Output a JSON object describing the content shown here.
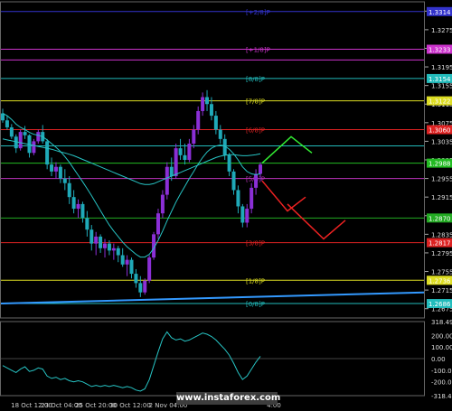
{
  "watermark": "www.instaforex.com",
  "colors": {
    "background": "#000000",
    "bull_candle": "#8b2fd6",
    "bear_candle": "#1fa9b8",
    "ma_fast": "#27c4c4",
    "ma_slow": "#27c4c4",
    "up_arrow": "#33ee33",
    "down_arrow": "#ee2222",
    "oscillator": "#27c4c4"
  },
  "chart_data": {
    "type": "candlestick",
    "y_range": [
      1.2655,
      1.3335
    ],
    "price_ticks": [
      "1.3315",
      "1.3275",
      "1.3235",
      "1.3195",
      "1.3155",
      "1.3115",
      "1.3075",
      "1.3035",
      "1.2995",
      "1.2955",
      "1.2915",
      "1.2875",
      "1.2835",
      "1.2795",
      "1.2755",
      "1.2715",
      "1.2675"
    ],
    "time_labels": [
      "18 Oct 12:00",
      "23 Oct 04:00",
      "25 Oct 20:00",
      "30 Oct 12:00",
      "2 Nov 04:00",
      "4:00"
    ],
    "levels": [
      {
        "label": "[+2/8]P",
        "price": 1.3314,
        "color": "#3333cc",
        "tag": "1.3314"
      },
      {
        "label": "[+1/8]P",
        "price": 1.3233,
        "color": "#cc33cc",
        "tag": "1.3233"
      },
      {
        "label": "",
        "price": 1.321,
        "color": "#cc33cc",
        "tag": ""
      },
      {
        "label": "[8/8]P",
        "price": 1.317,
        "color": "#22bbbb",
        "tag": "1.3154"
      },
      {
        "label": "[7/8]P",
        "price": 1.3122,
        "color": "#dddd22",
        "tag": "1.3122"
      },
      {
        "label": "[6/8]P",
        "price": 1.306,
        "color": "#dd2222",
        "tag": "1.3060"
      },
      {
        "label": "",
        "price": 1.3025,
        "color": "#22bbbb",
        "tag": ""
      },
      {
        "label": "",
        "price": 1.2988,
        "color": "#22bb22",
        "tag": "1.2988"
      },
      {
        "label": "[5/8]P",
        "price": 1.2955,
        "color": "#bb33bb",
        "tag": ""
      },
      {
        "label": "",
        "price": 1.287,
        "color": "#22aa22",
        "tag": "1.2870"
      },
      {
        "label": "[3/8]P",
        "price": 1.2817,
        "color": "#dd2222",
        "tag": "1.2817"
      },
      {
        "label": "[1/8]P",
        "price": 1.2736,
        "color": "#dddd22",
        "tag": "1.2736"
      },
      {
        "label": "[0/8]P",
        "price": 1.2686,
        "color": "#22bbbb",
        "tag": "1.2686"
      }
    ],
    "candles": [
      [
        1.3095,
        1.3105,
        1.3075,
        1.308
      ],
      [
        1.308,
        1.309,
        1.306,
        1.3065
      ],
      [
        1.3065,
        1.3072,
        1.304,
        1.3045
      ],
      [
        1.3045,
        1.305,
        1.301,
        1.302
      ],
      [
        1.302,
        1.306,
        1.3015,
        1.3055
      ],
      [
        1.3055,
        1.3068,
        1.304,
        1.3048
      ],
      [
        1.3048,
        1.305,
        1.3,
        1.301
      ],
      [
        1.301,
        1.304,
        1.3005,
        1.3035
      ],
      [
        1.3035,
        1.306,
        1.303,
        1.3055
      ],
      [
        1.3055,
        1.307,
        1.303,
        1.3035
      ],
      [
        1.3035,
        1.304,
        1.2975,
        1.2985
      ],
      [
        1.2985,
        1.3,
        1.296,
        1.297
      ],
      [
        1.297,
        1.299,
        1.2955,
        1.298
      ],
      [
        1.298,
        1.2985,
        1.2945,
        1.2955
      ],
      [
        1.2955,
        1.2975,
        1.293,
        1.2945
      ],
      [
        1.2945,
        1.296,
        1.29,
        1.2915
      ],
      [
        1.2915,
        1.293,
        1.288,
        1.289
      ],
      [
        1.289,
        1.291,
        1.287,
        1.29
      ],
      [
        1.29,
        1.2905,
        1.286,
        1.287
      ],
      [
        1.287,
        1.2885,
        1.283,
        1.2845
      ],
      [
        1.2845,
        1.2855,
        1.28,
        1.2815
      ],
      [
        1.2815,
        1.284,
        1.279,
        1.283
      ],
      [
        1.283,
        1.2835,
        1.2795,
        1.2805
      ],
      [
        1.2805,
        1.2825,
        1.2785,
        1.2815
      ],
      [
        1.2815,
        1.2822,
        1.279,
        1.28
      ],
      [
        1.28,
        1.2815,
        1.278,
        1.2805
      ],
      [
        1.2805,
        1.281,
        1.2775,
        1.279
      ],
      [
        1.279,
        1.2805,
        1.2765,
        1.277
      ],
      [
        1.277,
        1.279,
        1.2745,
        1.278
      ],
      [
        1.278,
        1.2785,
        1.274,
        1.275
      ],
      [
        1.275,
        1.276,
        1.272,
        1.273
      ],
      [
        1.273,
        1.2745,
        1.27,
        1.271
      ],
      [
        1.271,
        1.274,
        1.2705,
        1.2735
      ],
      [
        1.2735,
        1.279,
        1.273,
        1.2785
      ],
      [
        1.2785,
        1.284,
        1.278,
        1.2835
      ],
      [
        1.2835,
        1.289,
        1.2825,
        1.288
      ],
      [
        1.288,
        1.293,
        1.287,
        1.292
      ],
      [
        1.292,
        1.299,
        1.291,
        1.298
      ],
      [
        1.298,
        1.3,
        1.295,
        1.296
      ],
      [
        1.296,
        1.303,
        1.2955,
        1.302
      ],
      [
        1.302,
        1.304,
        1.2995,
        1.3005
      ],
      [
        1.3005,
        1.303,
        1.2985,
        1.2995
      ],
      [
        1.2995,
        1.304,
        1.299,
        1.303
      ],
      [
        1.303,
        1.307,
        1.302,
        1.306
      ],
      [
        1.306,
        1.311,
        1.305,
        1.31
      ],
      [
        1.31,
        1.314,
        1.309,
        1.313
      ],
      [
        1.313,
        1.3145,
        1.31,
        1.3115
      ],
      [
        1.3115,
        1.313,
        1.308,
        1.309
      ],
      [
        1.309,
        1.31,
        1.305,
        1.306
      ],
      [
        1.306,
        1.307,
        1.303,
        1.304
      ],
      [
        1.304,
        1.305,
        1.2995,
        1.3005
      ],
      [
        1.3005,
        1.301,
        1.296,
        1.297
      ],
      [
        1.297,
        1.2975,
        1.292,
        1.293
      ],
      [
        1.293,
        1.294,
        1.288,
        1.2895
      ],
      [
        1.2895,
        1.29,
        1.285,
        1.286
      ],
      [
        1.286,
        1.29,
        1.285,
        1.289
      ],
      [
        1.289,
        1.2945,
        1.288,
        1.2935
      ],
      [
        1.2935,
        1.2975,
        1.292,
        1.2965
      ],
      [
        1.2965,
        1.299,
        1.295,
        1.2985
      ]
    ],
    "ma_fast": [
      1.3095,
      1.309,
      1.3082,
      1.3072,
      1.3065,
      1.306,
      1.3054,
      1.305,
      1.3048,
      1.3045,
      1.3038,
      1.303,
      1.3022,
      1.3013,
      1.3002,
      1.299,
      1.2976,
      1.2962,
      1.2948,
      1.2933,
      1.2918,
      1.2902,
      1.2886,
      1.287,
      1.2855,
      1.2842,
      1.283,
      1.2818,
      1.2808,
      1.28,
      1.2792,
      1.2786,
      1.2786,
      1.2792,
      1.2805,
      1.2822,
      1.2842,
      1.2864,
      1.2884,
      1.2904,
      1.2922,
      1.2938,
      1.2955,
      1.297,
      1.2986,
      1.3,
      1.3012,
      1.302,
      1.3025,
      1.3027,
      1.3025,
      1.3018,
      1.3008,
      1.2995,
      1.298,
      1.297,
      1.2965,
      1.2963,
      1.2965
    ],
    "ma_slow": [
      1.304,
      1.3038,
      1.3036,
      1.3034,
      1.3032,
      1.303,
      1.3028,
      1.3026,
      1.3024,
      1.3022,
      1.302,
      1.3018,
      1.3015,
      1.3012,
      1.301,
      1.3007,
      1.3004,
      1.3,
      1.2996,
      1.2992,
      1.2988,
      1.2984,
      1.298,
      1.2976,
      1.2972,
      1.2968,
      1.2964,
      1.296,
      1.2956,
      1.2952,
      1.2948,
      1.2944,
      1.2942,
      1.2942,
      1.2944,
      1.2948,
      1.2952,
      1.2956,
      1.296,
      1.2964,
      1.2968,
      1.2972,
      1.2976,
      1.298,
      1.2984,
      1.2988,
      1.2992,
      1.2996,
      1.3,
      1.3003,
      1.3005,
      1.3006,
      1.3006,
      1.3005,
      1.3004,
      1.3004,
      1.3005,
      1.3006,
      1.3008
    ],
    "trend_line": {
      "from": 1.2686,
      "to": 1.271
    },
    "oscillator": {
      "range": [
        -318.4818,
        318.4907
      ],
      "ticks": [
        "318.4907",
        "200.00",
        "100.00",
        "0.00",
        "-100.00",
        "-200.00",
        "-318.4818"
      ],
      "values": [
        -60,
        -80,
        -100,
        -120,
        -90,
        -70,
        -110,
        -100,
        -80,
        -90,
        -150,
        -170,
        -160,
        -180,
        -170,
        -190,
        -200,
        -190,
        -200,
        -220,
        -240,
        -230,
        -240,
        -230,
        -240,
        -230,
        -240,
        -250,
        -240,
        -250,
        -270,
        -280,
        -260,
        -180,
        -60,
        60,
        170,
        230,
        180,
        160,
        170,
        150,
        160,
        180,
        200,
        220,
        210,
        190,
        160,
        120,
        80,
        30,
        -40,
        -120,
        -180,
        -150,
        -90,
        -30,
        20
      ]
    },
    "projections": {
      "up": [
        [
          1.2988,
          1.3045,
          1.301
        ]
      ],
      "down": [
        [
          1.295,
          1.2885,
          1.2915
        ],
        [
          1.29,
          1.2825,
          1.2865
        ]
      ]
    }
  }
}
